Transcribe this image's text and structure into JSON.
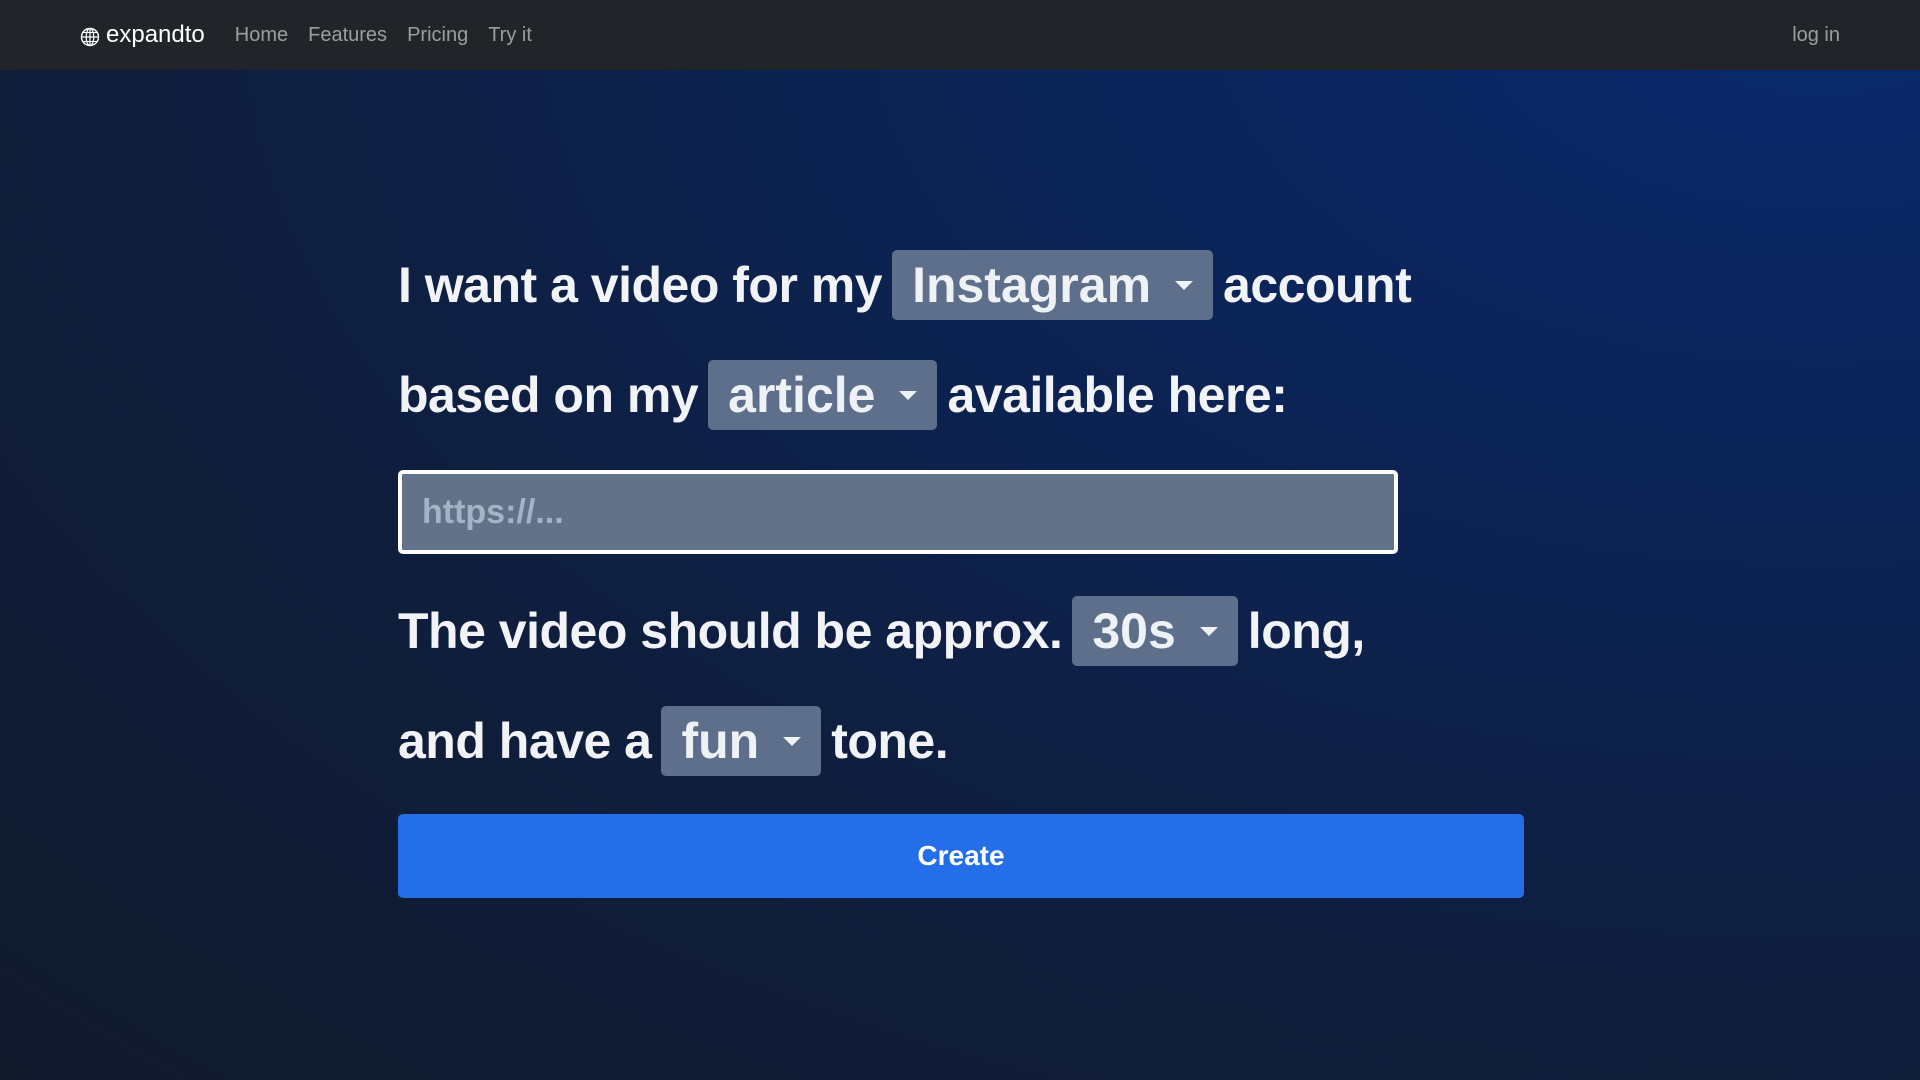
{
  "nav": {
    "brand": "expandto",
    "brand_icon": "globe-icon",
    "links": [
      "Home",
      "Features",
      "Pricing",
      "Try it"
    ],
    "login": "log in"
  },
  "form": {
    "line1": {
      "before": "I want a video for my",
      "platform": "Instagram",
      "after": "account"
    },
    "line2": {
      "before": "based on my",
      "source": "article",
      "after": "available here:"
    },
    "url_placeholder": "https://...",
    "url_value": "",
    "line3": {
      "before": "The video should be approx.",
      "duration": "30s",
      "after": "long,"
    },
    "line4": {
      "before": "and have a",
      "tone": "fun",
      "after": "tone."
    },
    "create_label": "Create"
  },
  "colors": {
    "navbar_bg": "#212529",
    "select_bg": "#5d6f8a",
    "button_bg": "#246ee9"
  }
}
